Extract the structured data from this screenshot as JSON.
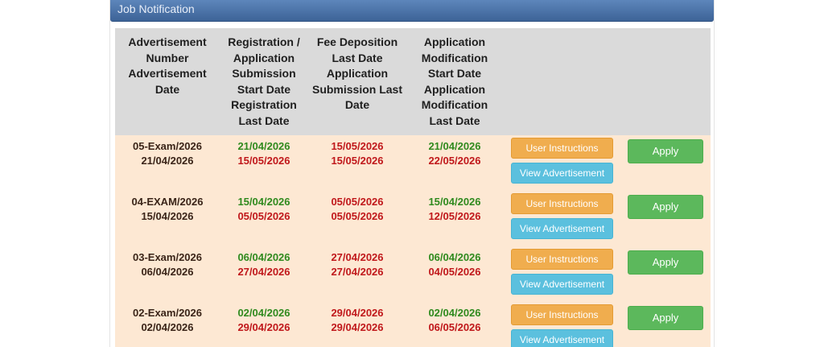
{
  "panel": {
    "title": "Job Notification"
  },
  "table": {
    "headers": [
      [
        "Advertisement",
        "Number",
        "Advertisement",
        "Date"
      ],
      [
        "Registration /",
        "Application",
        "Submission",
        "Start Date",
        "Registration",
        "Last Date"
      ],
      [
        "Fee Deposition",
        "Last Date",
        "Application",
        "Submission Last",
        "Date"
      ],
      [
        "Application",
        "Modification",
        "Start Date",
        "Application",
        "Modification",
        "Last Date"
      ]
    ],
    "rows": [
      {
        "adv_number": "05-Exam/2026",
        "adv_date": "21/04/2026",
        "reg_start": "21/04/2026",
        "reg_last": "15/05/2026",
        "fee_last": "15/05/2026",
        "sub_last": "15/05/2026",
        "mod_start": "21/04/2026",
        "mod_last": "22/05/2026"
      },
      {
        "adv_number": "04-EXAM/2026",
        "adv_date": "15/04/2026",
        "reg_start": "15/04/2026",
        "reg_last": "05/05/2026",
        "fee_last": "05/05/2026",
        "sub_last": "05/05/2026",
        "mod_start": "15/04/2026",
        "mod_last": "12/05/2026"
      },
      {
        "adv_number": "03-Exam/2026",
        "adv_date": "06/04/2026",
        "reg_start": "06/04/2026",
        "reg_last": "27/04/2026",
        "fee_last": "27/04/2026",
        "sub_last": "27/04/2026",
        "mod_start": "06/04/2026",
        "mod_last": "04/05/2026"
      },
      {
        "adv_number": "02-Exam/2026",
        "adv_date": "02/04/2026",
        "reg_start": "02/04/2026",
        "reg_last": "29/04/2026",
        "fee_last": "29/04/2026",
        "sub_last": "29/04/2026",
        "mod_start": "02/04/2026",
        "mod_last": "06/05/2026"
      }
    ]
  },
  "buttons": {
    "user_instructions": "User Instructions",
    "view_advertisement": "View Advertisement",
    "apply": "Apply"
  },
  "colors": {
    "header_bar": "#4a71a8",
    "row_background": "#fde8d3",
    "head_background": "#dadada",
    "start_date": "#2f8a1e",
    "last_date": "#c0181b",
    "user_instructions_button": "#f0ad4e",
    "view_advertisement_button": "#5bc0de",
    "apply_button": "#5cb85c"
  }
}
